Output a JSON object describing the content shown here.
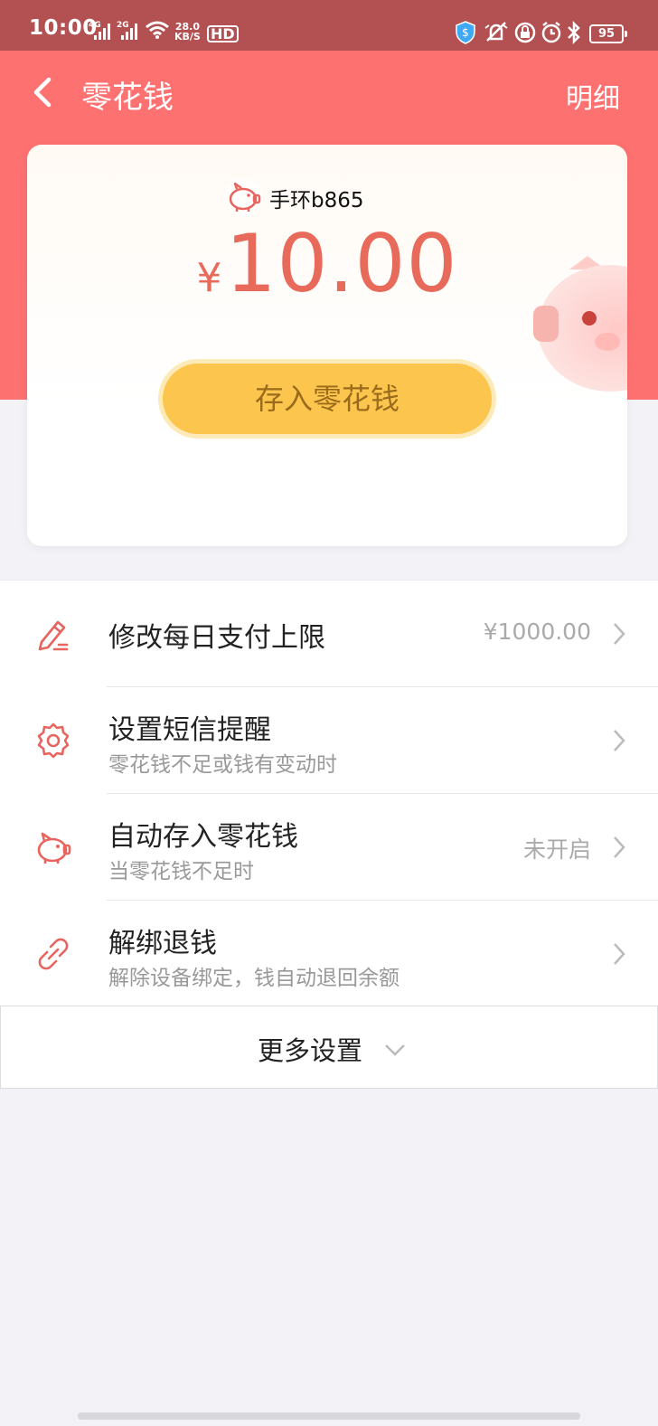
{
  "status_bar": {
    "time": "10:00",
    "signal_1": "4G",
    "signal_2": "2G",
    "net_speed_value": "28.0",
    "net_speed_unit": "KB/S",
    "hd_label": "HD",
    "battery": "95"
  },
  "header": {
    "title": "零花钱",
    "detail_link": "明细"
  },
  "card": {
    "device_name": "手环b865",
    "currency": "¥",
    "amount": "10.00",
    "deposit_button": "存入零花钱"
  },
  "settings": [
    {
      "title": "修改每日支付上限",
      "subtitle": "",
      "value": "¥1000.00",
      "icon": "pencil-icon"
    },
    {
      "title": "设置短信提醒",
      "subtitle": "零花钱不足或钱有变动时",
      "value": "",
      "icon": "gear-icon"
    },
    {
      "title": "自动存入零花钱",
      "subtitle": "当零花钱不足时",
      "value": "未开启",
      "icon": "piggy-bank-icon"
    },
    {
      "title": "解绑退钱",
      "subtitle": "解除设备绑定，钱自动退回余额",
      "value": "",
      "icon": "unlink-icon"
    }
  ],
  "more_settings": "更多设置",
  "colors": {
    "header_bg": "#fe7171",
    "status_bar_bg": "#b25052",
    "amount": "#e86a5a",
    "button": "#fcc64e",
    "icon_red": "#e8645e"
  }
}
